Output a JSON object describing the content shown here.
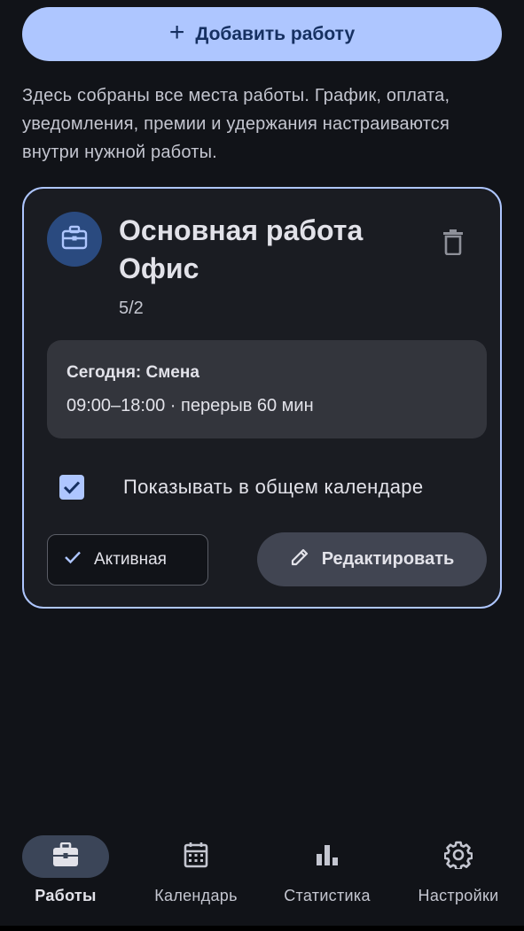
{
  "add_button": {
    "label": "Добавить работу",
    "icon": "plus-icon"
  },
  "intro_text": "Здесь собраны все места работы. График, оплата, уведомления, премии и удержания настраиваются внутри нужной работы.",
  "job_card": {
    "icon": "briefcase-icon",
    "title_line1": "Основная работа",
    "title_line2": "Офис",
    "schedule": "5/2",
    "delete_icon": "trash-icon",
    "today": {
      "heading": "Сегодня: Смена",
      "time": "09:00–18:00 · перерыв 60 мин"
    },
    "show_in_calendar": {
      "label": "Показывать в общем календаре",
      "checked": true
    },
    "active_button": {
      "label": "Активная",
      "icon": "check-icon"
    },
    "edit_button": {
      "label": "Редактировать",
      "icon": "pencil-icon"
    }
  },
  "bottom_nav": {
    "items": [
      {
        "label": "Работы",
        "icon": "briefcase-icon",
        "active": true
      },
      {
        "label": "Календарь",
        "icon": "calendar-icon",
        "active": false
      },
      {
        "label": "Статистика",
        "icon": "bar-chart-icon",
        "active": false
      },
      {
        "label": "Настройки",
        "icon": "gear-icon",
        "active": false
      }
    ]
  },
  "colors": {
    "background": "#111318",
    "accent": "#aec6ff",
    "card": "#1a1c22",
    "surface": "#33353c",
    "nav_active": "#3b4558"
  }
}
